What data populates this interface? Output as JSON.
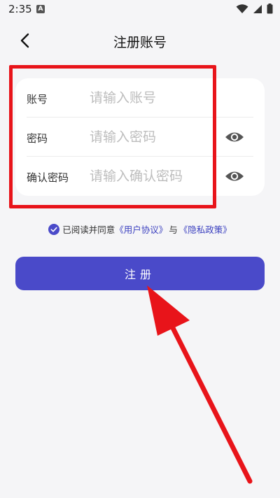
{
  "status_bar": {
    "time": "2:35",
    "notification_letter": "A",
    "icons": [
      "wifi-icon",
      "signal-icon",
      "battery-icon"
    ]
  },
  "header": {
    "title": "注册账号",
    "back_icon": "chevron-left-icon"
  },
  "form": {
    "rows": [
      {
        "label": "账号",
        "placeholder": "请输入账号",
        "value": "",
        "has_eye": false
      },
      {
        "label": "密码",
        "placeholder": "请输入密码",
        "value": "",
        "has_eye": true
      },
      {
        "label": "确认密码",
        "placeholder": "请输入确认密码",
        "value": "",
        "has_eye": true
      }
    ],
    "eye_icon": "eye-icon"
  },
  "agreement": {
    "checked": true,
    "prefix": "已阅读并同意",
    "user_agreement": "《用户协议》",
    "conjunction": "与",
    "privacy_policy": "《隐私政策》"
  },
  "register_button": {
    "label": "注册"
  },
  "annotations": {
    "highlight_color": "#e8141a",
    "arrow_color": "#e8141a"
  },
  "colors": {
    "accent": "#4a4ac9",
    "link": "#3a3fbf",
    "background": "#f5f5f7"
  }
}
